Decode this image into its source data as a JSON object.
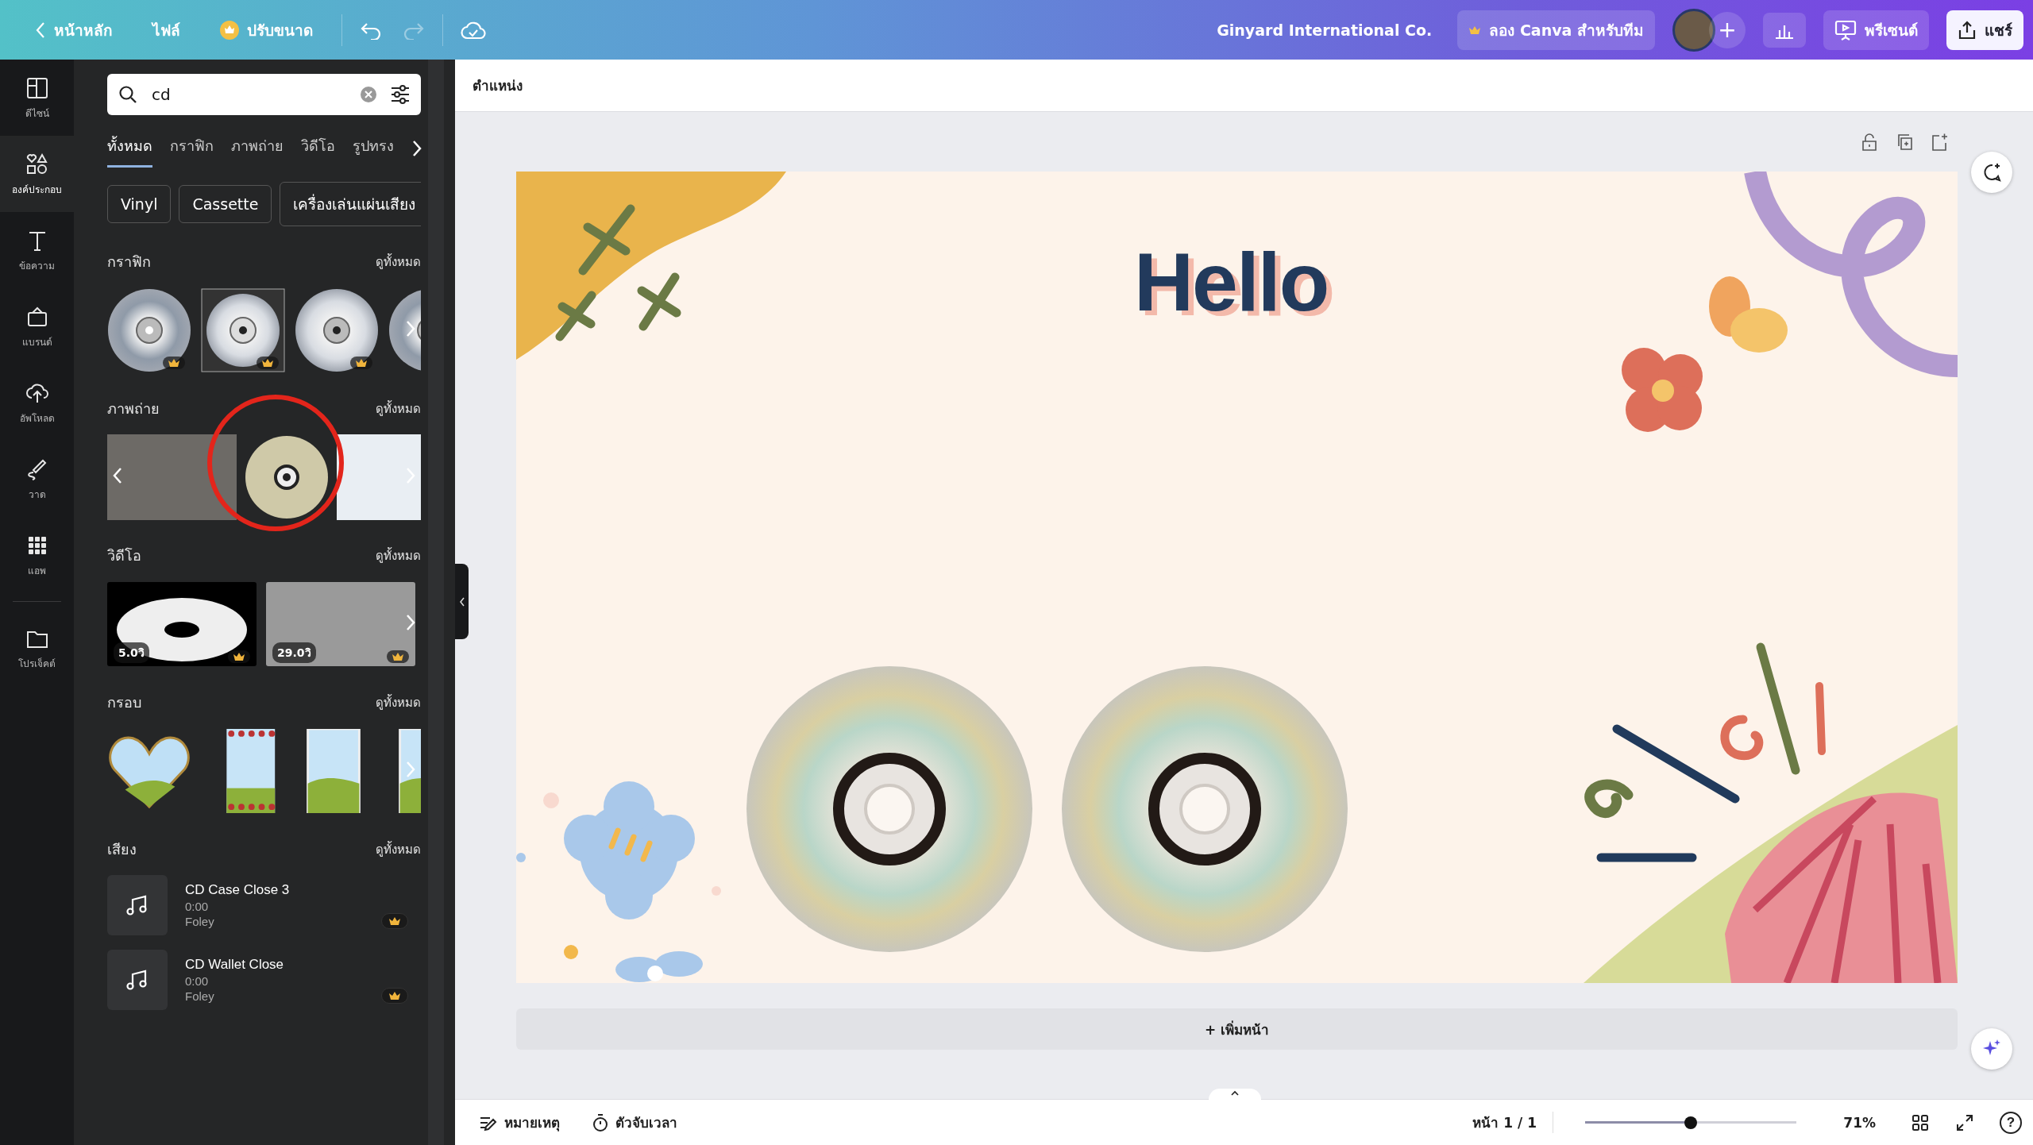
{
  "top_bar": {
    "back": "หน้าหลัก",
    "file": "ไฟล์",
    "resize": "ปรับขนาด",
    "undo": {
      "disabled": false
    },
    "redo": {
      "disabled": true
    },
    "team": "Ginyard International Co.",
    "try_teams": "ลอง Canva สำหรับทีม",
    "add": "+",
    "present": "พรีเซนต์",
    "share": "แชร์"
  },
  "rail": [
    {
      "kind": "design",
      "label": "ดีไซน์",
      "selected": false
    },
    {
      "kind": "elements",
      "label": "องค์ประกอบ",
      "selected": true
    },
    {
      "kind": "text",
      "label": "ข้อความ",
      "selected": false
    },
    {
      "kind": "brand",
      "label": "แบรนด์",
      "selected": false
    },
    {
      "kind": "uploads",
      "label": "อัพโหลด",
      "selected": false
    },
    {
      "kind": "draw",
      "label": "วาด",
      "selected": false
    },
    {
      "kind": "apps",
      "label": "แอพ",
      "selected": false
    },
    {
      "kind": "projects",
      "label": "โปรเจ็คต์",
      "selected": false
    }
  ],
  "panel": {
    "search": {
      "value": "cd"
    },
    "tabs": [
      {
        "label": "ทั้งหมด",
        "selected": true
      },
      {
        "label": "กราฟิก",
        "selected": false
      },
      {
        "label": "ภาพถ่าย",
        "selected": false
      },
      {
        "label": "วิดีโอ",
        "selected": false
      },
      {
        "label": "รูปทรง",
        "selected": false
      }
    ],
    "chips": [
      "Vinyl",
      "Cassette",
      "เครื่องเล่นแผ่นเสียง"
    ],
    "graphics": {
      "title": "กราฟิก",
      "see_all": "ดูทั้งหมด",
      "items": [
        {
          "kind": "disc",
          "premium": true
        },
        {
          "kind": "case",
          "premium": true
        },
        {
          "kind": "shiny",
          "premium": true
        },
        {
          "kind": "disc",
          "premium": false
        }
      ]
    },
    "photos": {
      "title": "ภาพถ่าย",
      "see_all": "ดูทั้งหมด",
      "items": [
        {
          "circled": false
        },
        {
          "circled": true
        },
        {
          "circled": false
        }
      ]
    },
    "videos": {
      "title": "วิดีโอ",
      "see_all": "ดูทั้งหมด",
      "items": [
        {
          "duration": "5.0วิ",
          "premium": true
        },
        {
          "duration": "29.0วิ",
          "premium": true
        }
      ]
    },
    "frames": {
      "title": "กรอบ",
      "see_all": "ดูทั้งหมด",
      "items": [
        {
          "kind": "heart"
        },
        {
          "kind": "flowers"
        },
        {
          "kind": "plain"
        },
        {
          "kind": "plain"
        }
      ]
    },
    "sounds": {
      "title": "เสียง",
      "see_all": "ดูทั้งหมด",
      "items": [
        {
          "title": "CD Case Close 3",
          "duration": "0:00",
          "category": "Foley",
          "premium": true
        },
        {
          "title": "CD Wallet Close",
          "duration": "0:00",
          "category": "Foley",
          "premium": true
        }
      ]
    }
  },
  "canvas": {
    "context_label": "ตำแหน่ง",
    "slide": {
      "title": "Hello"
    },
    "add_page": "+ เพิ่มหน้า"
  },
  "bottom_bar": {
    "notes": "หมายเหตุ",
    "timer": "ตัวจับเวลา",
    "page": "หน้า 1 / 1",
    "zoom": {
      "level": 0.5,
      "reading": "71%"
    },
    "help": "?"
  }
}
